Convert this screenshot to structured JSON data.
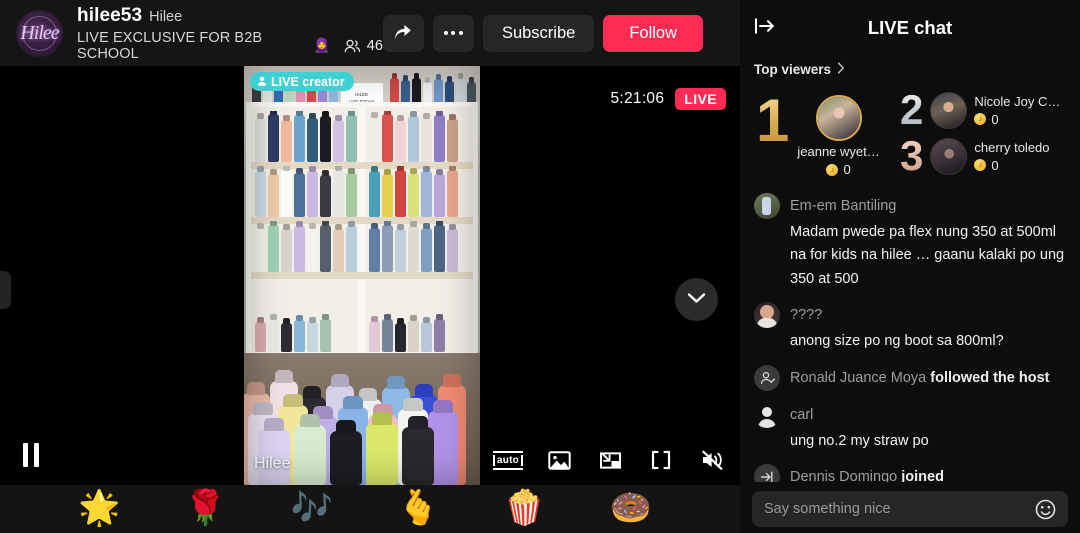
{
  "header": {
    "avatar_label": "Hilee",
    "username": "hilee53",
    "nickname": "Hilee",
    "tagline": "LIVE EXCLUSIVE FOR B2B SCHOOL",
    "tagline_emoji": "🧕",
    "viewer_icon": "people-icon",
    "viewer_count": "46",
    "share_icon": "share-arrow-icon",
    "more_icon": "more-options-icon",
    "subscribe_label": "Subscribe",
    "follow_label": "Follow",
    "follow_color": "#fe2c55"
  },
  "player": {
    "live_creator_badge": "LIVE creator",
    "live_creator_icon": "person-icon",
    "live_creator_color": "#3fd0d4",
    "timer": "5:21:06",
    "live_badge": "LIVE",
    "live_badge_color": "#fe2c55",
    "watermark": "Hilee",
    "scroll_down_icon": "chevron-down-icon",
    "pause_icon": "pause-icon",
    "edge_handle": "panel-handle",
    "sign_line1": "HILEE",
    "sign_line2": "LiVE TODAY",
    "sign_line3": "SEPT 04 2023",
    "controls": [
      {
        "name": "quality-auto-button",
        "label": "auto",
        "icon": "quality-auto-icon"
      },
      {
        "name": "gallery-button",
        "label": "",
        "icon": "picture-icon"
      },
      {
        "name": "picture-in-picture-button",
        "label": "",
        "icon": "pip-icon"
      },
      {
        "name": "fullscreen-button",
        "label": "",
        "icon": "fullscreen-icon"
      },
      {
        "name": "mute-button",
        "label": "",
        "icon": "volume-muted-icon"
      }
    ]
  },
  "gifts": [
    {
      "name": "gift-star",
      "glyph": "🌟"
    },
    {
      "name": "gift-rose",
      "glyph": "🌹"
    },
    {
      "name": "gift-music-note",
      "glyph": "🎶"
    },
    {
      "name": "gift-finger-heart",
      "glyph": "🫰"
    },
    {
      "name": "gift-popcorn",
      "glyph": "🍿"
    },
    {
      "name": "gift-donut",
      "glyph": "🍩"
    }
  ],
  "chat": {
    "collapse_icon": "collapse-panel-icon",
    "title": "LIVE chat",
    "top_viewers_label": "Top viewers",
    "top_viewers_chevron": "chevron-right-icon",
    "top_viewers": [
      {
        "rank": "1",
        "name": "jeanne wyet…",
        "coins": "0",
        "coin_icon": "coin-icon"
      },
      {
        "rank": "2",
        "name": "Nicole Joy C…",
        "coins": "0",
        "coin_icon": "coin-icon"
      },
      {
        "rank": "3",
        "name": "cherry toledo",
        "coins": "0",
        "coin_icon": "coin-icon"
      }
    ],
    "messages": [
      {
        "type": "message",
        "avatar": "user-avatar",
        "name": "Em-em Bantiling",
        "text": "Madam pwede pa flex nung 350 at 500ml na for kids na hilee … gaanu kalaki po ung 350 at 500"
      },
      {
        "type": "message",
        "avatar": "user-avatar",
        "name": "????",
        "text": "anong size po ng boot sa 800ml?"
      },
      {
        "type": "system",
        "avatar": "follow-icon",
        "name": "Ronald Juance Moya",
        "action": "followed the host"
      },
      {
        "type": "message",
        "avatar": "default-avatar",
        "name": "carl",
        "text": "ung no.2 my straw po"
      },
      {
        "type": "system",
        "avatar": "enter-icon",
        "name": "Dennis Domingo",
        "action": "joined"
      }
    ],
    "input_placeholder": "Say something nice",
    "emoji_icon": "emoji-smiley-icon"
  }
}
